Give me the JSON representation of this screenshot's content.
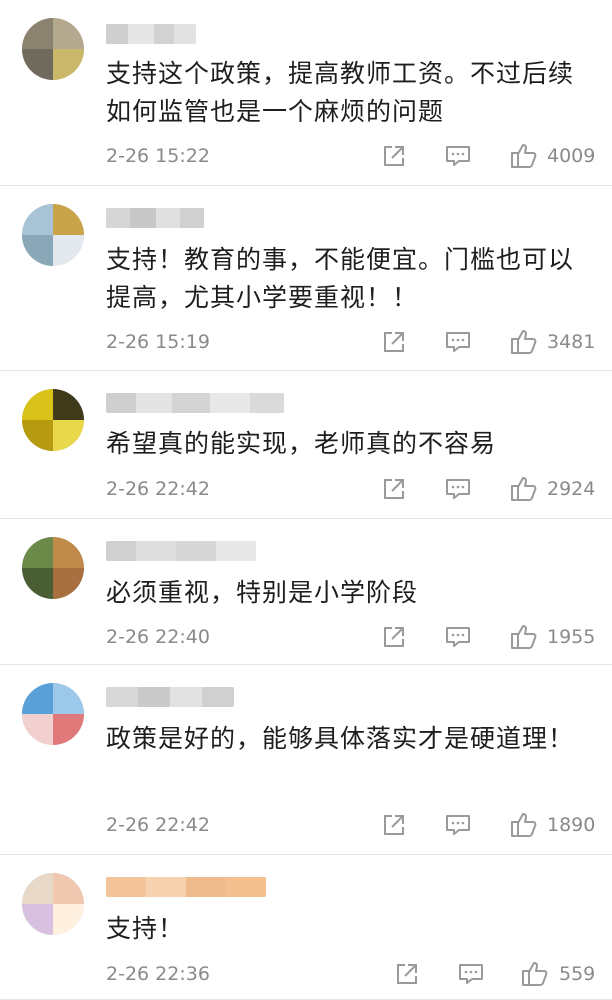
{
  "comments": [
    {
      "text": "支持这个政策，提高教师工资。不过后续如何监管也是一个麻烦的问题",
      "time": "2-26 15:22",
      "likes": "4009",
      "avatar_colors": [
        "#8b8270",
        "#b4a88f",
        "#6f6a5c",
        "#c9b86a"
      ]
    },
    {
      "text": "支持！教育的事，不能便宜。门槛也可以提高，尤其小学要重视！！",
      "time": "2-26 15:19",
      "likes": "3481",
      "avatar_colors": [
        "#a9c3d6",
        "#c9a34a",
        "#8aa7b8",
        "#e3e9ee"
      ]
    },
    {
      "text": "希望真的能实现，老师真的不容易",
      "time": "2-26 22:42",
      "likes": "2924",
      "avatar_colors": [
        "#d9c21a",
        "#3f3a1a",
        "#b69a10",
        "#e8d84a"
      ]
    },
    {
      "text": "必须重视，特别是小学阶段",
      "time": "2-26 22:40",
      "likes": "1955",
      "avatar_colors": [
        "#6b8a4a",
        "#c08a4a",
        "#4a5e33",
        "#a87040"
      ]
    },
    {
      "text": "政策是好的，能够具体落实才是硬道理！",
      "time": "2-26 22:42",
      "likes": "1890",
      "avatar_colors": [
        "#5aa0d8",
        "#e07a7a",
        "#9cc8ea",
        "#f2d0d0"
      ]
    },
    {
      "text": "支持！",
      "time": "2-26 22:36",
      "likes": "559",
      "avatar_colors": [
        "#e8d8c8",
        "#f0c8b0",
        "#d8c0e0",
        "#fff0e0"
      ]
    }
  ],
  "colors": {
    "meta_text": "#8a8a8a",
    "comment_text": "#1e1e1e",
    "icon": "#9a9a9a",
    "divider": "#e6e6e6"
  },
  "icons": {
    "share": "share-icon",
    "reply": "comment-icon",
    "like": "thumbs-up-icon"
  }
}
